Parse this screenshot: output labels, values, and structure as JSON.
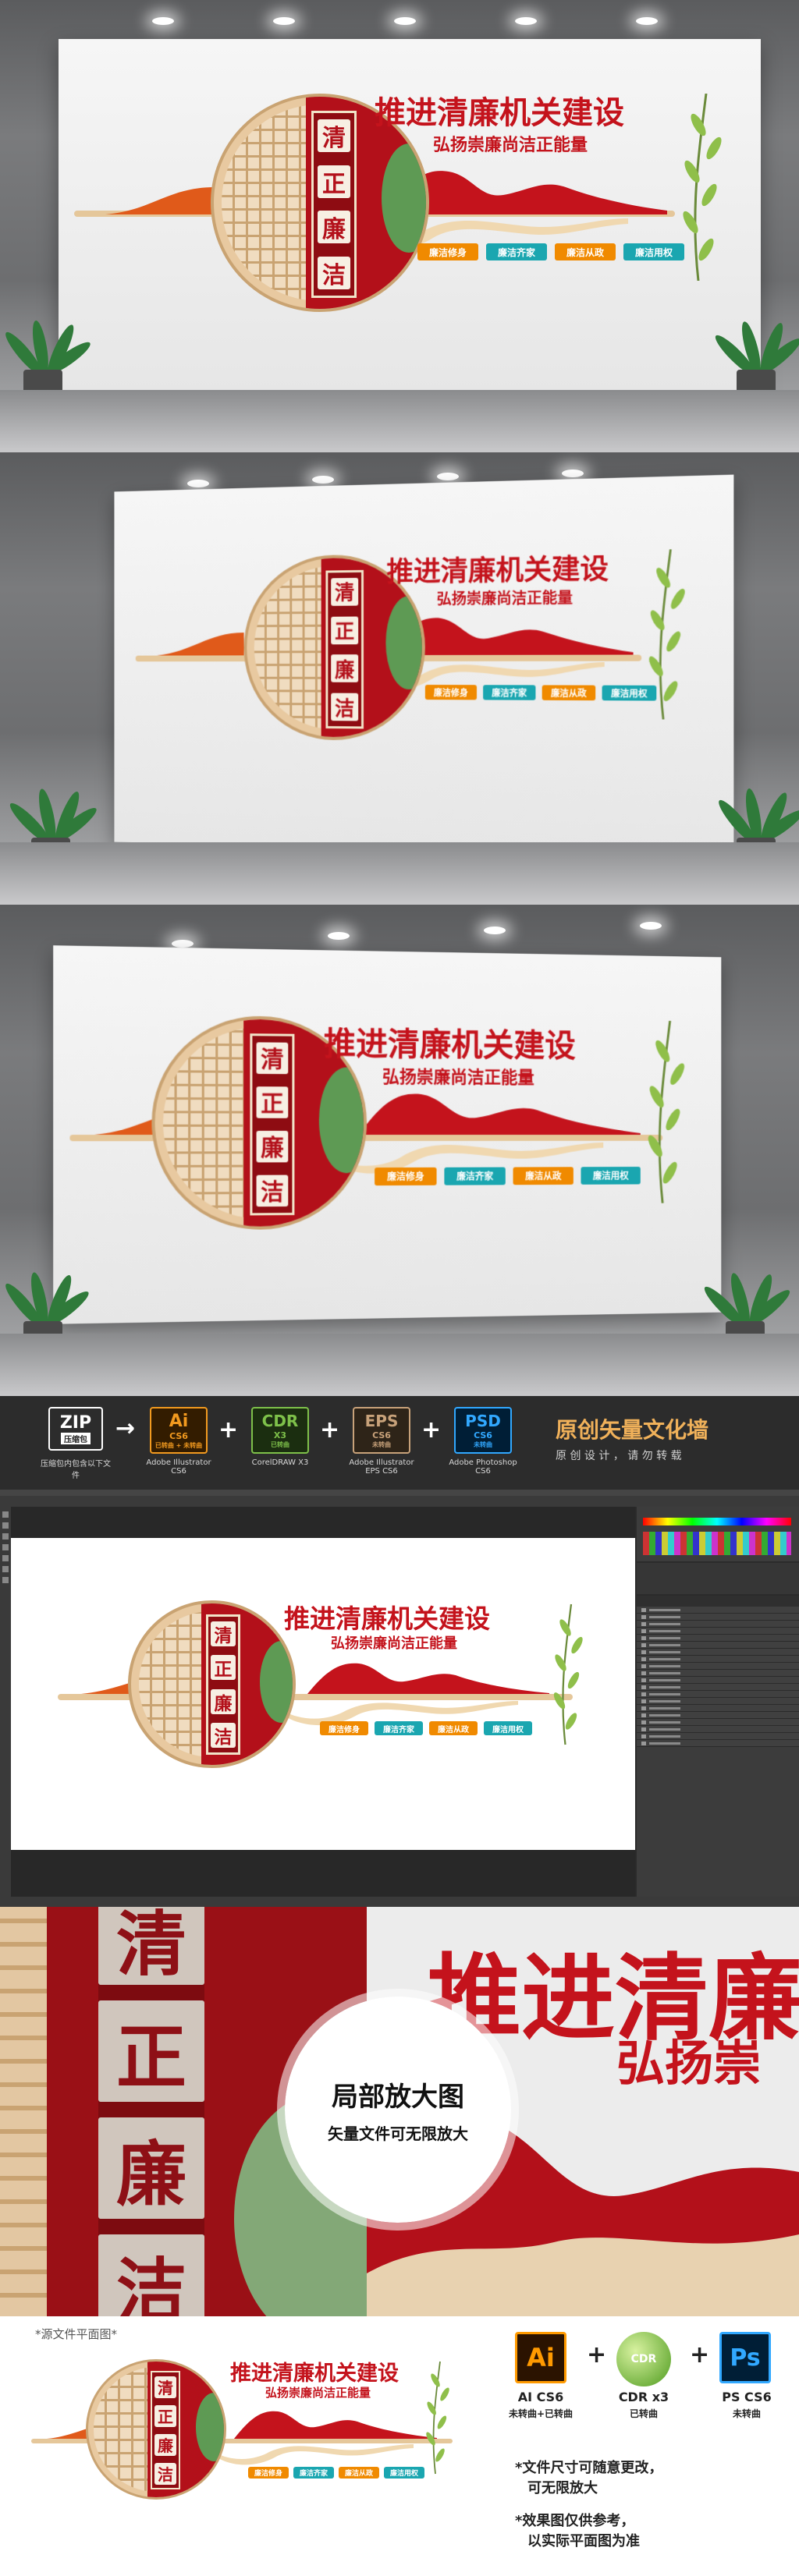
{
  "design": {
    "vertical_chars": [
      "清",
      "正",
      "廉",
      "洁"
    ],
    "title": "推进清廉机关建设",
    "subtitle": "弘扬崇廉尚洁正能量",
    "tags": [
      {
        "label": "廉洁修身",
        "color": "#f08a00"
      },
      {
        "label": "廉洁齐家",
        "color": "#1aa6b0"
      },
      {
        "label": "廉洁从政",
        "color": "#f08a00"
      },
      {
        "label": "廉洁用权",
        "color": "#1aa6b0"
      }
    ]
  },
  "formats_bar": {
    "zip": {
      "label": "ZIP",
      "sub": "压缩包",
      "caption": "压缩包内包含以下文件"
    },
    "ai": {
      "label": "Ai",
      "ver": "CS6",
      "sub": "已转曲 + 未转曲",
      "caption": "Adobe Illustrator CS6"
    },
    "cdr": {
      "label": "CDR",
      "ver": "X3",
      "sub": "已转曲",
      "caption": "CorelDRAW X3"
    },
    "eps": {
      "label": "EPS",
      "ver": "CS6",
      "sub": "未转曲",
      "caption": "Adobe Illustrator EPS CS6"
    },
    "psd": {
      "label": "PSD",
      "ver": "CS6",
      "sub": "未转曲",
      "caption": "Adobe Photoshop CS6"
    },
    "headline": "原创矢量文化墙",
    "tagline": "原 创 设 计 ， 请 勿 转 载"
  },
  "zoom": {
    "bubble_title": "局部放大图",
    "bubble_sub": "矢量文件可无限放大",
    "big_chars": [
      "清",
      "正",
      "廉",
      "洁"
    ],
    "big_title": "推进清廉",
    "big_sub": "弘扬崇"
  },
  "bottom": {
    "heading": "*源文件平面图*",
    "software": [
      {
        "logo": "Ai",
        "name": "AI CS6",
        "status": "未转曲+已转曲"
      },
      {
        "logo": "CDR",
        "name": "CDR x3",
        "status": "已转曲"
      },
      {
        "logo": "Ps",
        "name": "PS CS6",
        "status": "未转曲"
      }
    ],
    "notes": [
      "*文件尺寸可随意更改，",
      "可无限放大",
      "*效果图仅供参考，",
      "以实际平面图为准"
    ]
  }
}
